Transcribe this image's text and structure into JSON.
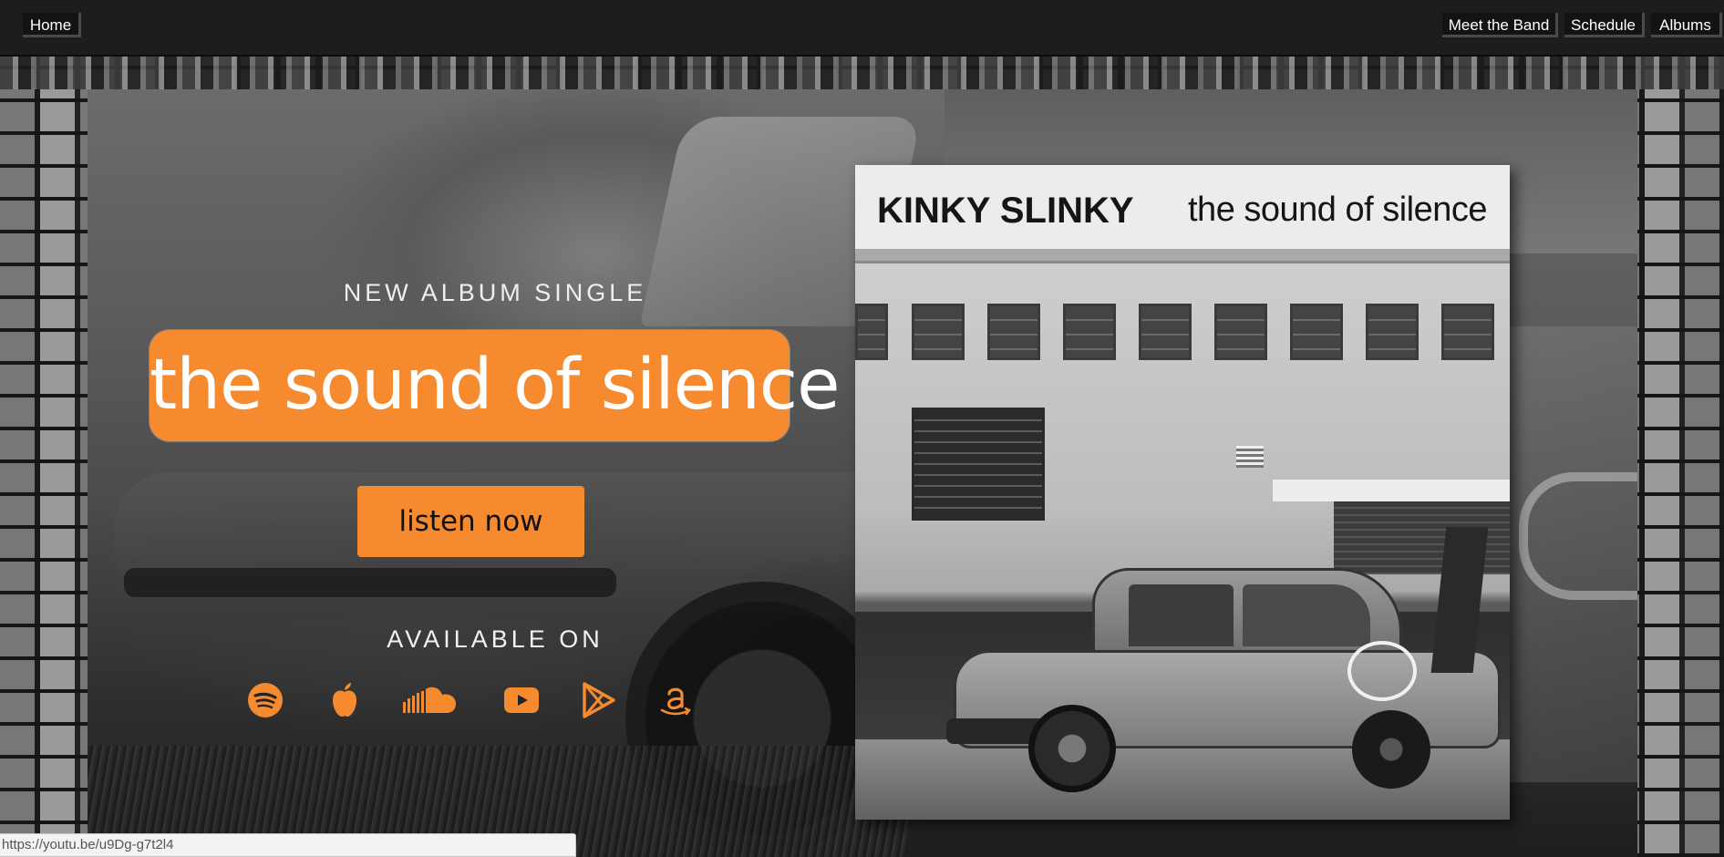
{
  "nav": {
    "home": "Home",
    "meet_the_band": "Meet the Band",
    "schedule": "Schedule",
    "albums": "Albums"
  },
  "hero": {
    "eyebrow": "NEW ALBUM SINGLE",
    "title": "the sound of silence",
    "cta": "listen now",
    "available_on": "AVAILABLE ON",
    "platforms": [
      {
        "icon": "spotify-icon"
      },
      {
        "icon": "apple-icon"
      },
      {
        "icon": "soundcloud-icon"
      },
      {
        "icon": "youtube-icon"
      },
      {
        "icon": "google-play-icon"
      },
      {
        "icon": "amazon-icon"
      }
    ]
  },
  "album_cover": {
    "band": "KINKY SLINKY",
    "title": "the sound of silence"
  },
  "status_bar": {
    "url": "https://youtu.be/u9Dg-g7t2l4"
  },
  "colors": {
    "accent": "#f58a2f",
    "nav_bg": "#1e1d1b"
  }
}
